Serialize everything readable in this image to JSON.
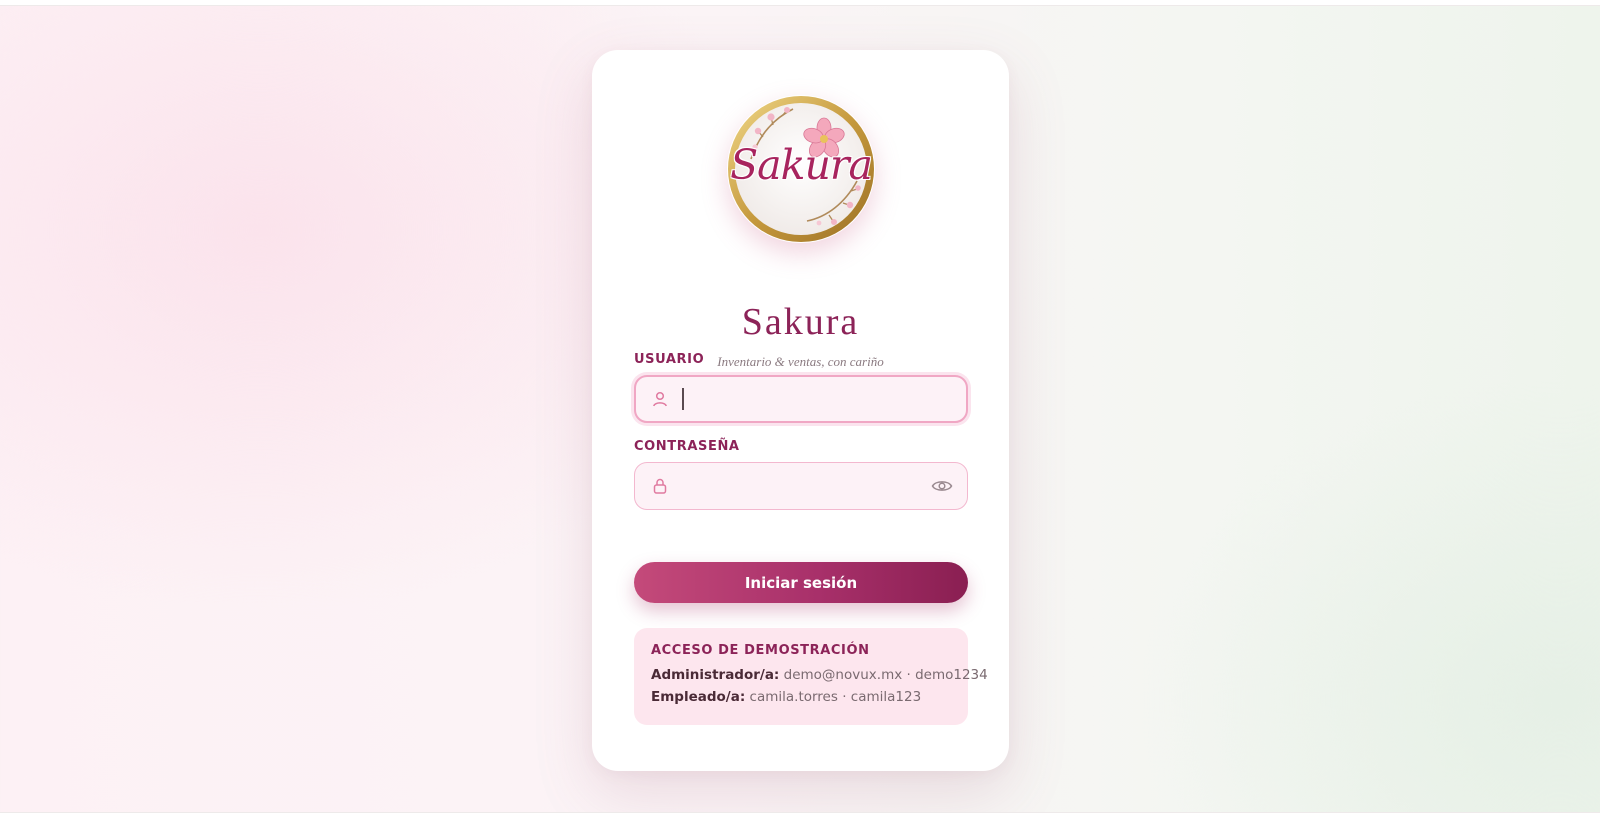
{
  "brand": {
    "logo_text": "Sakura",
    "name": "Sakura",
    "tagline": "Inventario & ventas, con cariño"
  },
  "form": {
    "username": {
      "label": "USUARIO",
      "value": "",
      "icon": "user-icon"
    },
    "password": {
      "label": "CONTRASEÑA",
      "value": "",
      "icon": "lock-icon",
      "toggle_icon": "eye-icon"
    },
    "submit_label": "Iniciar sesión"
  },
  "demo": {
    "title": "ACCESO DE DEMOSTRACIÓN",
    "accounts": [
      {
        "role": "Administrador/a:",
        "credentials": "demo@novux.mx · demo1234"
      },
      {
        "role": "Empleado/a:",
        "credentials": "camila.torres · camila123"
      }
    ]
  },
  "colors": {
    "accent": "#8c2358",
    "button_start": "#c44a7a",
    "button_end": "#8a1f52",
    "field_bg": "#fdf2f7",
    "field_border": "#f3b8cf",
    "demo_bg": "#fde6ee"
  }
}
